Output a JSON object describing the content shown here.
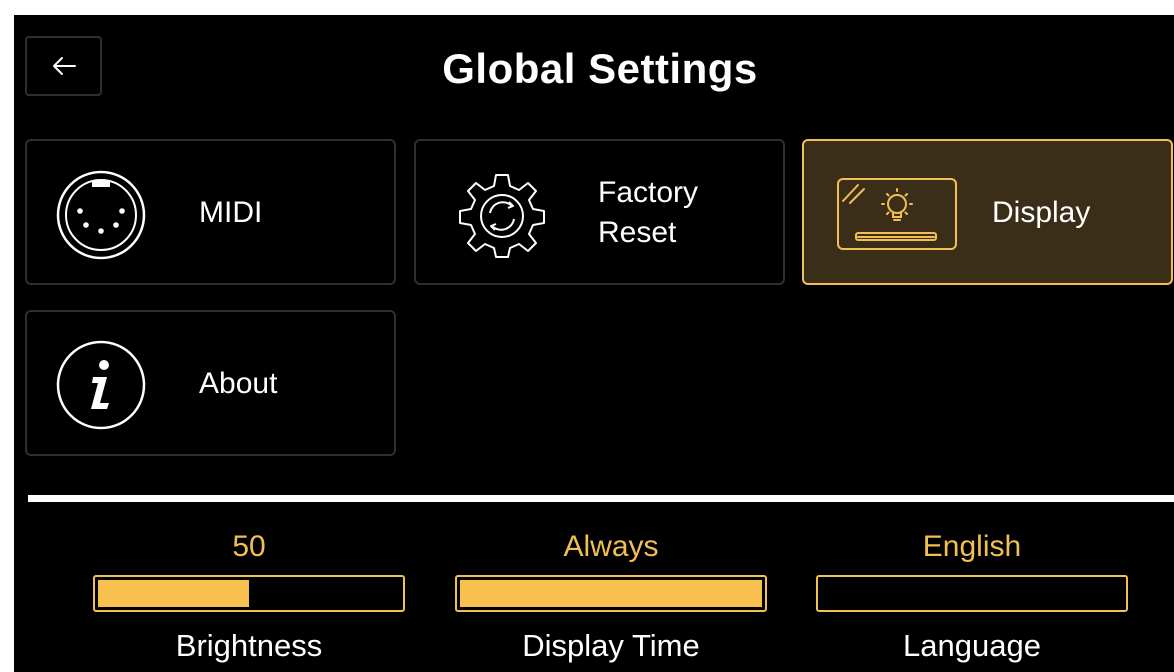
{
  "header": {
    "title": "Global Settings"
  },
  "tiles": {
    "midi": {
      "label": "MIDI"
    },
    "factory_reset": {
      "label_line1": "Factory",
      "label_line2": "Reset"
    },
    "display": {
      "label": "Display"
    },
    "about": {
      "label": "About"
    }
  },
  "controls": {
    "brightness": {
      "value": "50",
      "label": "Brightness",
      "level": 0.5
    },
    "display_time": {
      "value": "Always",
      "label": "Display Time",
      "level": 1.0
    },
    "language": {
      "value": "English",
      "label": "Language",
      "level": 0.0
    }
  },
  "colors": {
    "accent": "#f2bf52",
    "active_tile_bg": "#3a2e19",
    "background": "#000000"
  },
  "icons": [
    "back-arrow-icon",
    "midi-connector-icon",
    "gear-reset-icon",
    "display-brightness-icon",
    "info-icon"
  ]
}
